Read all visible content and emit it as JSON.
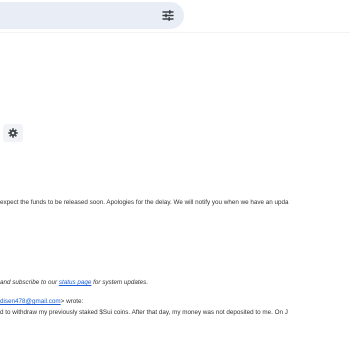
{
  "search": {
    "options_icon": "tune-icon"
  },
  "toolbar": {
    "settings_icon": "gear-icon"
  },
  "message": {
    "body_fragment": "expect the funds to be released soon. Apologies for the delay. We will notify you when we have an upda",
    "subscribe_prefix": "and subscribe to our ",
    "status_link": "status page",
    "subscribe_suffix": " for system updates.",
    "quote_email": "disen478@gmail.com",
    "quote_wrote": "> wrote:",
    "quoted_text": "d to withdraw my previously staked $Sui coins. After that day, my money was not deposited to me. On J"
  },
  "colors": {
    "link": "#1a5fd8",
    "search_bg": "#e9eef6"
  }
}
